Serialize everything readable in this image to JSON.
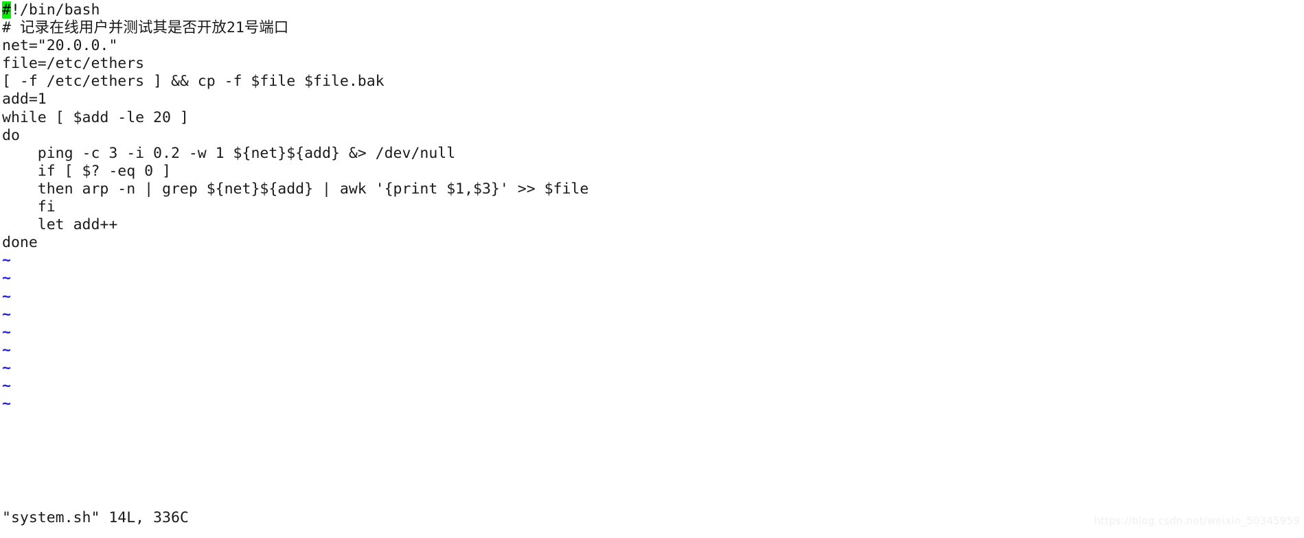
{
  "editor": {
    "name": "vim",
    "filename": "system.sh",
    "background_color": "#ffffff",
    "foreground_color": "#1a1a1a",
    "cursor_color": "#00ee00",
    "tilde_color": "#2222e0"
  },
  "cursor": {
    "line": 1,
    "column": 1,
    "character": "#"
  },
  "buffer": {
    "lines": [
      {
        "id": "line-1",
        "indent": "",
        "text": "!/bin/bash",
        "cursor_char": "#",
        "has_cursor": true,
        "kind": "code"
      },
      {
        "id": "line-2",
        "indent": "",
        "text": "# 记录在线用户并测试其是否开放21号端口",
        "kind": "cjk"
      },
      {
        "id": "line-3",
        "indent": "",
        "text": "net=\"20.0.0.\"",
        "kind": "code"
      },
      {
        "id": "line-4",
        "indent": "",
        "text": "file=/etc/ethers",
        "kind": "code"
      },
      {
        "id": "line-5",
        "indent": "",
        "text": "[ -f /etc/ethers ] && cp -f $file $file.bak",
        "kind": "code"
      },
      {
        "id": "line-6",
        "indent": "",
        "text": "add=1",
        "kind": "code"
      },
      {
        "id": "line-7",
        "indent": "",
        "text": "while [ $add -le 20 ]",
        "kind": "code"
      },
      {
        "id": "line-8",
        "indent": "",
        "text": "do",
        "kind": "code"
      },
      {
        "id": "line-9",
        "indent": "   ",
        "text": " ping -c 3 -i 0.2 -w 1 ${net}${add} &> /dev/null",
        "kind": "code"
      },
      {
        "id": "line-10",
        "indent": "   ",
        "text": " if [ $? -eq 0 ]",
        "kind": "code"
      },
      {
        "id": "line-11",
        "indent": "   ",
        "text": " then arp -n | grep ${net}${add} | awk '{print $1,$3}' >> $file",
        "kind": "code"
      },
      {
        "id": "line-12",
        "indent": "   ",
        "text": " fi",
        "kind": "code"
      },
      {
        "id": "line-13",
        "indent": "   ",
        "text": " let add++",
        "kind": "code"
      },
      {
        "id": "line-14",
        "indent": "",
        "text": "done",
        "kind": "code"
      }
    ],
    "empty_markers": [
      "~",
      "~",
      "~",
      "~",
      "~",
      "~",
      "~",
      "~",
      "~"
    ]
  },
  "statusline": {
    "text": "\"system.sh\" 14L, 336C",
    "file_label": "\"system.sh\"",
    "line_count": "14L",
    "byte_count": "336C"
  },
  "watermark": {
    "text": "https://blog.csdn.net/weixin_50345959"
  }
}
